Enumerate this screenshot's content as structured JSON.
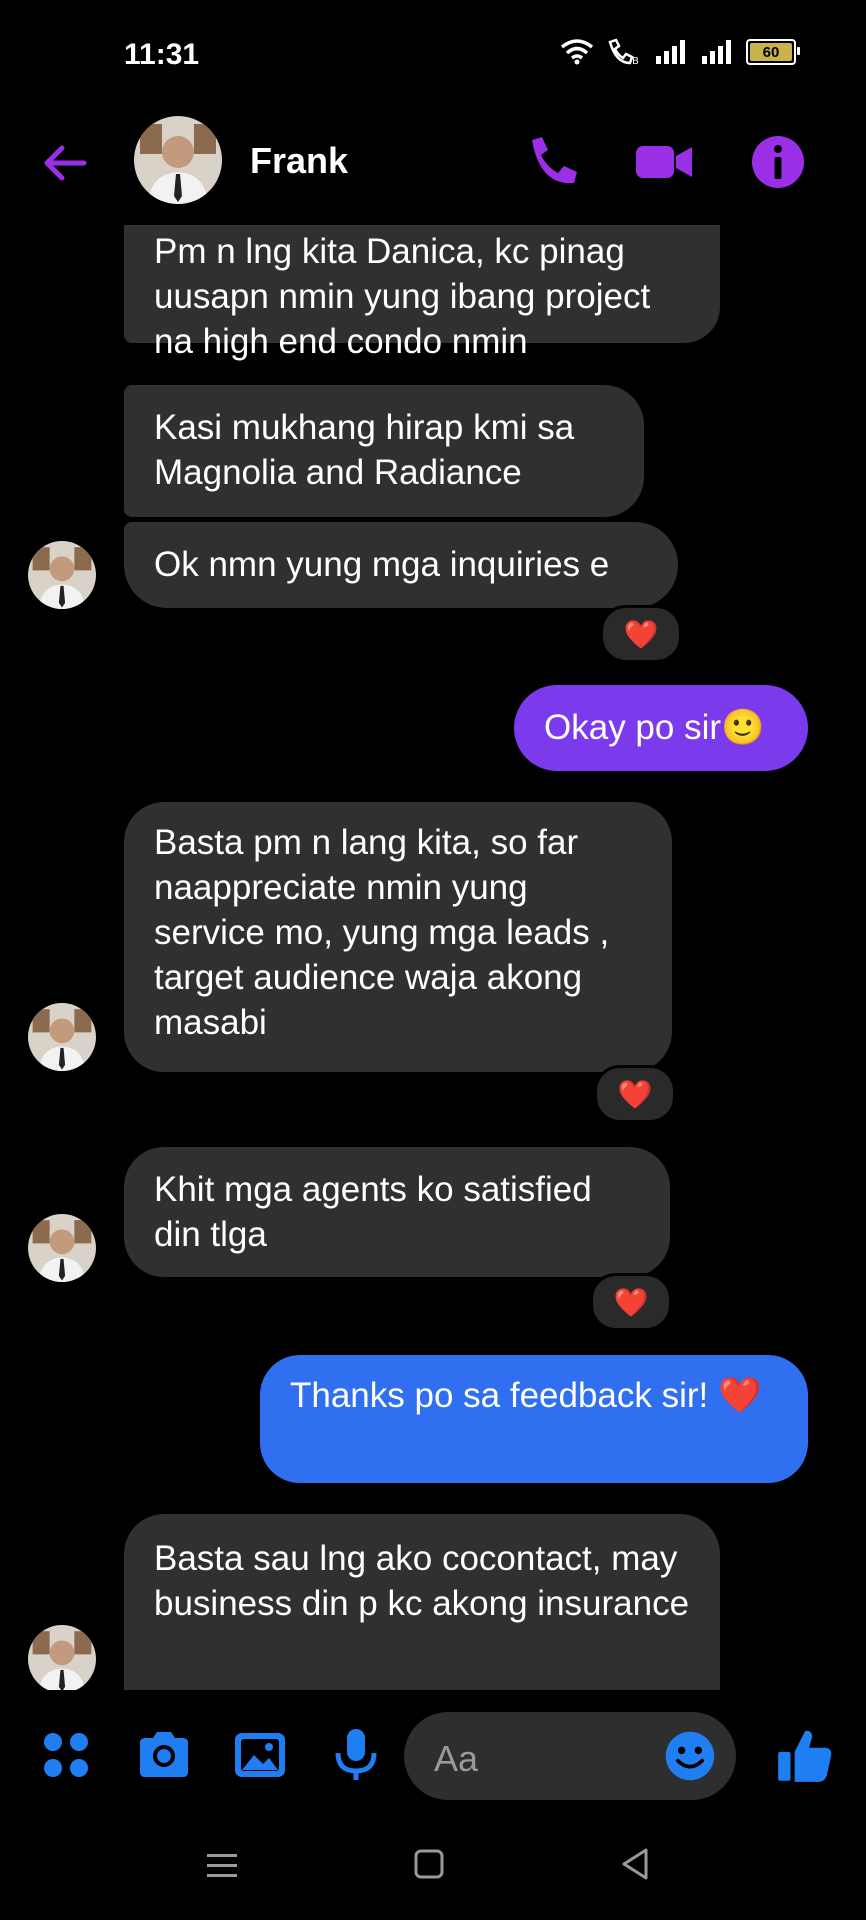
{
  "status_bar": {
    "time": "11:31",
    "battery": "60"
  },
  "header": {
    "contact_name": "Frank"
  },
  "messages": [
    {
      "from": "them",
      "text": "Pm n lng kita Danica, kc pinag uusapn nmin yung ibang project na high end condo nmin"
    },
    {
      "from": "them",
      "text": "Kasi mukhang hirap kmi sa Magnolia and Radiance"
    },
    {
      "from": "them",
      "text": "Ok nmn yung mga inquiries e",
      "reaction": "❤️"
    },
    {
      "from": "me",
      "text": "Okay po sir🙂"
    },
    {
      "from": "them",
      "text": "Basta pm n lang kita, so far naappreciate nmin yung service mo, yung mga leads , target audience waja akong masabi",
      "reaction": "❤️"
    },
    {
      "from": "them",
      "text": "Khit mga agents ko satisfied din tlga",
      "reaction": "❤️"
    },
    {
      "from": "me",
      "text": "Thanks po sa feedback sir! ❤️"
    },
    {
      "from": "them",
      "text": "Basta sau lng ako cocontact, may business din p kc akong insurance"
    }
  ],
  "composer": {
    "placeholder": "Aa"
  },
  "colors": {
    "accent_purple": "#9b2fe6",
    "my_bubble_purple": "#7c3aed",
    "my_bubble_blue": "#2f6ff0",
    "their_bubble": "#303030",
    "composer_blue": "#1f7ef2"
  }
}
